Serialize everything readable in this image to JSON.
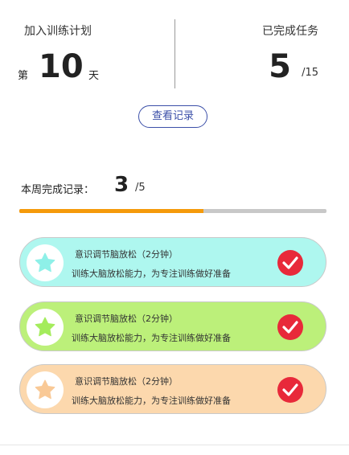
{
  "plan": {
    "label": "加入训练计划",
    "day_prefix": "第",
    "day_value": "10",
    "day_suffix": "天"
  },
  "tasks": {
    "label": "已完成任务",
    "completed": "5",
    "total": "/15"
  },
  "record_button": "查看记录",
  "week": {
    "label": "本周完成记录：",
    "completed": "3",
    "total": "/5",
    "progress_fraction": 0.6,
    "progress_color": "#f59a0b"
  },
  "cards": [
    {
      "title": "意识调节脑放松（2分钟）",
      "desc": "训练大脑放松能力，为专注训练做好准备",
      "bg": "#aef7ef",
      "star_color": "#8ef0e8",
      "icon": "star-icon",
      "done": true
    },
    {
      "title": "意识调节脑放松（2分钟）",
      "desc": "训练大脑放松能力，为专注训练做好准备",
      "bg": "#bcf07a",
      "star_color": "#a4ec5c",
      "icon": "star-icon",
      "done": true
    },
    {
      "title": "意识调节脑放松（2分钟）",
      "desc": "训练大脑放松能力，为专注训练做好准备",
      "bg": "#fcd8ad",
      "star_color": "#f9c996",
      "icon": "star-icon",
      "done": true
    }
  ],
  "check_color": "#e8293a"
}
